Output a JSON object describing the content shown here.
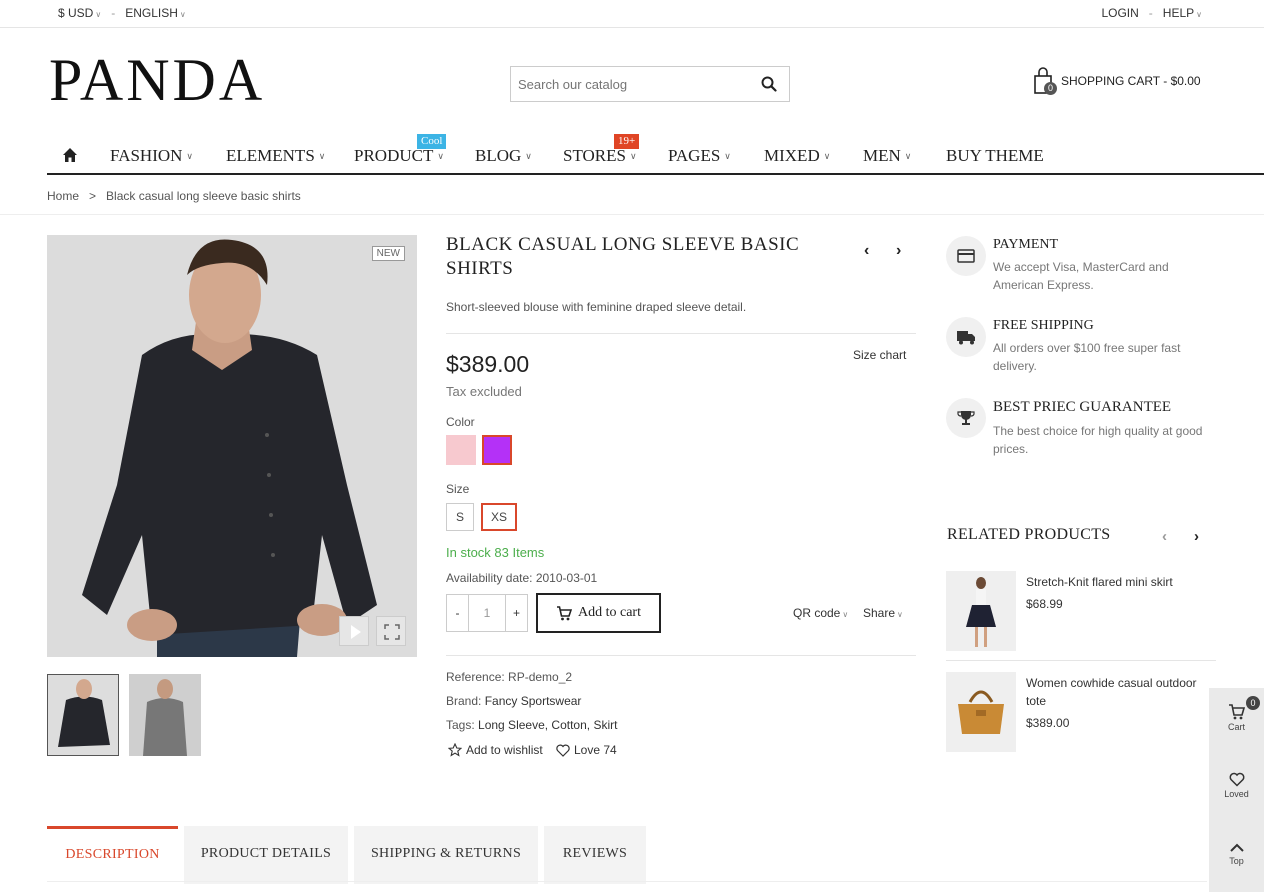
{
  "topbar": {
    "currency": "$ USD",
    "language": "ENGLISH",
    "login": "LOGIN",
    "help": "HELP",
    "separator": "-"
  },
  "header": {
    "logo": "PANDA",
    "search_placeholder": "Search our catalog",
    "cart_label": "SHOPPING CART - $0.00",
    "cart_count": "0"
  },
  "nav": {
    "items": [
      "FASHION",
      "ELEMENTS",
      "PRODUCT",
      "BLOG",
      "STORES",
      "PAGES",
      "MIXED",
      "MEN",
      "BUY THEME"
    ],
    "badge_product": "Cool",
    "badge_stores": "19+"
  },
  "breadcrumb": {
    "home": "Home",
    "sep": ">",
    "current": "Black casual long sleeve basic shirts"
  },
  "gallery": {
    "new_tag": "NEW"
  },
  "product": {
    "title": "BLACK CASUAL LONG SLEEVE BASIC SHIRTS",
    "description": "Short-sleeved blouse with feminine draped sleeve detail.",
    "price": "$389.00",
    "size_chart": "Size chart",
    "tax": "Tax excluded",
    "color_label": "Color",
    "colors": [
      "#f7c9cf",
      "#b431f7"
    ],
    "size_label": "Size",
    "sizes": [
      "S",
      "XS"
    ],
    "stock": "In stock 83 Items",
    "availability": "Availability date: 2010-03-01",
    "qty_minus": "-",
    "qty_value": "1",
    "qty_plus": "+",
    "add_to_cart": "Add to cart",
    "qr_code": "QR code",
    "share": "Share",
    "reference_label": "Reference:",
    "reference_value": "RP-demo_2",
    "brand_label": "Brand:",
    "brand_value": "Fancy Sportswear",
    "tags_label": "Tags:",
    "tags_value": "Long Sleeve, Cotton, Skirt",
    "wishlist": "Add to wishlist",
    "love": "Love 74"
  },
  "features": [
    {
      "title": "PAYMENT",
      "desc": "We accept Visa, MasterCard and American Express."
    },
    {
      "title": "FREE SHIPPING",
      "desc": "All orders over $100 free super fast delivery."
    },
    {
      "title": "BEST PRIEC GUARANTEE",
      "desc": "The best choice for high quality at good prices."
    }
  ],
  "related": {
    "title": "RELATED PRODUCTS",
    "items": [
      {
        "name": "Stretch-Knit flared mini skirt",
        "price": "$68.99"
      },
      {
        "name": "Women cowhide casual outdoor tote",
        "price": "$389.00"
      }
    ]
  },
  "sticky": {
    "cart": "Cart",
    "cart_count": "0",
    "loved": "Loved",
    "top": "Top"
  },
  "tabs": [
    "DESCRIPTION",
    "PRODUCT DETAILS",
    "SHIPPING & RETURNS",
    "REVIEWS"
  ]
}
